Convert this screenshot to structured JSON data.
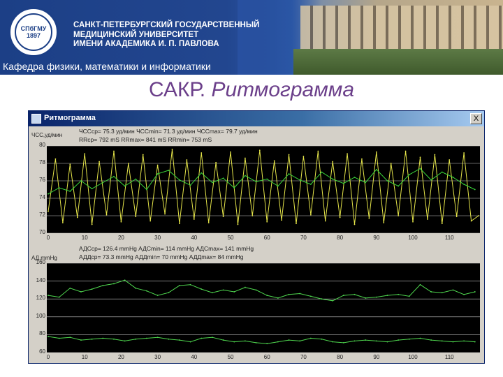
{
  "header": {
    "university_name": [
      "САНКТ-ПЕТЕРБУРГСКИЙ ГОСУДАРСТВЕННЫЙ",
      "МЕДИЦИНСКИЙ УНИВЕРСИТЕТ",
      "ИМЕНИ АКАДЕМИКА И. П. ПАВЛОВА"
    ],
    "logo_text": "СПбГМУ 1897",
    "department": "Кафедра физики, математики и информатики"
  },
  "slide": {
    "title_plain": "САКР.",
    "title_italic": "Ритмограмма"
  },
  "window": {
    "title": "Ритмограмма",
    "close_label": "X",
    "top_chart": {
      "ylabel": "ЧСС,уд/мин",
      "stats_line1": "ЧССср= 75.3 уд/мин ЧССmin= 71.3 уд/мин ЧССmax= 79.7 уд/мин",
      "stats_line2": "RRср= 792 mS RRmax= 841 mS RRmin= 753 mS"
    },
    "bottom_chart": {
      "ylabel": "АД,mmHg",
      "stats_line1": "АДСср= 126.4 mmHg АДСmin= 114 mmHg АДСmax= 141 mmHg",
      "stats_line2": "АДДср= 73.3 mmHg АДДmin= 70 mmHg АДДmax= 84 mmHg"
    }
  },
  "chart_data": [
    {
      "type": "line",
      "ylabel": "ЧСС,уд/мин",
      "ylim": [
        70,
        80
      ],
      "yticks": [
        70,
        72,
        74,
        76,
        78,
        80
      ],
      "xlim": [
        0,
        118
      ],
      "xticks": [
        0,
        10,
        20,
        30,
        40,
        50,
        60,
        70,
        80,
        90,
        100,
        110
      ],
      "grid": "horizontal",
      "series": [
        {
          "color": "#e6e64a",
          "style": "oscillating",
          "x": [
            0,
            2,
            4,
            6,
            8,
            10,
            12,
            14,
            16,
            18,
            20,
            22,
            24,
            26,
            28,
            30,
            32,
            34,
            36,
            38,
            40,
            42,
            44,
            46,
            48,
            50,
            52,
            54,
            56,
            58,
            60,
            62,
            64,
            66,
            68,
            70,
            72,
            74,
            76,
            78,
            80,
            82,
            84,
            86,
            88,
            90,
            92,
            94,
            96,
            98,
            100,
            102,
            104,
            106,
            108,
            110,
            112,
            114,
            116,
            118
          ],
          "values": [
            72.5,
            78.5,
            71.2,
            77.9,
            71.8,
            79.1,
            71.0,
            78.2,
            72.1,
            79.4,
            71.3,
            78.0,
            71.9,
            79.0,
            71.4,
            77.8,
            72.2,
            79.6,
            71.1,
            78.4,
            71.6,
            79.2,
            71.2,
            78.1,
            71.9,
            79.3,
            71.0,
            78.6,
            72.0,
            79.5,
            71.3,
            78.3,
            71.5,
            79.0,
            71.1,
            78.8,
            72.1,
            79.4,
            71.4,
            78.2,
            71.8,
            79.1,
            71.0,
            78.5,
            71.7,
            79.3,
            71.2,
            78.0,
            72.0,
            79.4,
            71.3,
            78.7,
            71.6,
            79.0,
            71.1,
            78.4,
            71.9,
            79.2,
            71.4,
            72.0
          ]
        },
        {
          "color": "#3ad63a",
          "style": "trend",
          "x": [
            0,
            3,
            6,
            9,
            12,
            15,
            18,
            21,
            24,
            27,
            30,
            33,
            36,
            39,
            42,
            45,
            48,
            51,
            54,
            57,
            60,
            63,
            66,
            69,
            72,
            75,
            78,
            81,
            84,
            87,
            90,
            93,
            96,
            99,
            102,
            105,
            108,
            111,
            114,
            117
          ],
          "values": [
            74.5,
            75.2,
            74.8,
            76.0,
            75.1,
            75.8,
            76.5,
            75.4,
            76.2,
            75.0,
            76.8,
            77.2,
            76.1,
            75.5,
            76.9,
            75.8,
            76.3,
            75.2,
            76.6,
            75.9,
            76.2,
            75.4,
            76.8,
            76.1,
            75.6,
            77.0,
            76.2,
            75.7,
            76.4,
            75.8,
            77.3,
            76.0,
            75.4,
            76.7,
            77.4,
            76.1,
            77.0,
            76.4,
            75.6,
            75.0
          ]
        }
      ]
    },
    {
      "type": "line",
      "ylabel": "АД,mmHg",
      "ylim": [
        60,
        160
      ],
      "yticks": [
        60,
        80,
        100,
        120,
        140,
        160
      ],
      "xlim": [
        0,
        118
      ],
      "xticks": [
        0,
        10,
        20,
        30,
        40,
        50,
        60,
        70,
        80,
        90,
        100,
        110
      ],
      "grid": "horizontal",
      "series": [
        {
          "color": "#4fd84f",
          "x": [
            0,
            3,
            6,
            9,
            12,
            15,
            18,
            21,
            24,
            27,
            30,
            33,
            36,
            39,
            42,
            45,
            48,
            51,
            54,
            57,
            60,
            63,
            66,
            69,
            72,
            75,
            78,
            81,
            84,
            87,
            90,
            93,
            96,
            99,
            102,
            105,
            108,
            111,
            114,
            117
          ],
          "values": [
            124,
            122,
            132,
            128,
            131,
            135,
            137,
            141,
            132,
            129,
            124,
            127,
            135,
            136,
            131,
            127,
            130,
            128,
            133,
            130,
            124,
            121,
            125,
            126,
            123,
            120,
            118,
            124,
            125,
            121,
            122,
            124,
            125,
            123,
            136,
            128,
            127,
            130,
            125,
            128
          ]
        },
        {
          "color": "#4fd84f",
          "x": [
            0,
            3,
            6,
            9,
            12,
            15,
            18,
            21,
            24,
            27,
            30,
            33,
            36,
            39,
            42,
            45,
            48,
            51,
            54,
            57,
            60,
            63,
            66,
            69,
            72,
            75,
            78,
            81,
            84,
            87,
            90,
            93,
            96,
            99,
            102,
            105,
            108,
            111,
            114,
            117
          ],
          "values": [
            78,
            76,
            77,
            74,
            75,
            76,
            75,
            73,
            75,
            76,
            77,
            75,
            74,
            72,
            76,
            77,
            74,
            72,
            73,
            71,
            70,
            72,
            74,
            73,
            76,
            75,
            72,
            71,
            73,
            74,
            73,
            72,
            74,
            75,
            76,
            74,
            73,
            72,
            73,
            72
          ]
        }
      ]
    }
  ]
}
